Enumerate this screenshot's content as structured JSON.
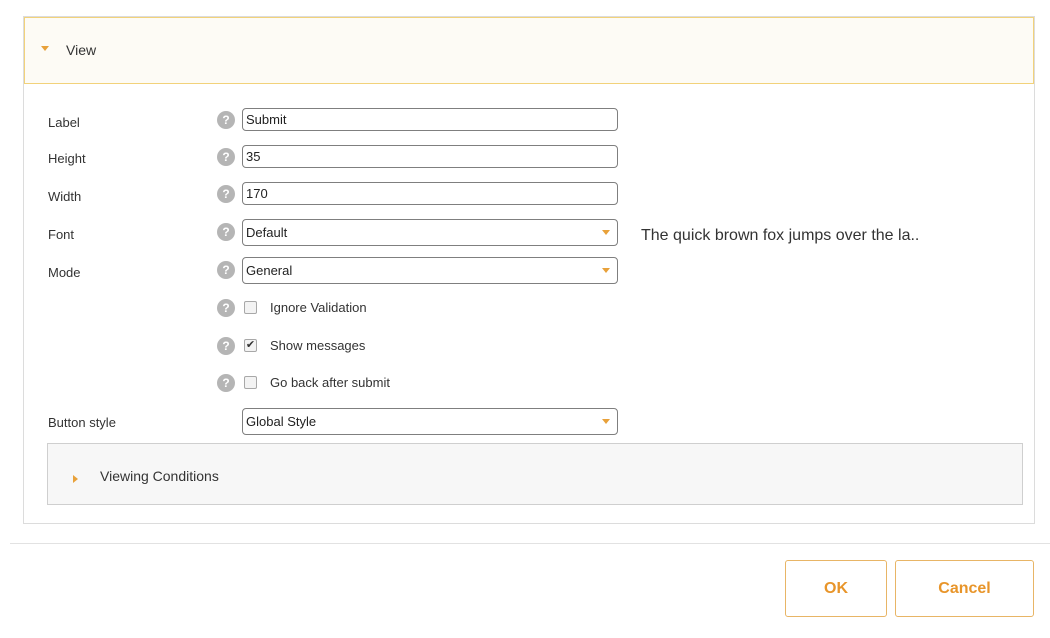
{
  "view_section": {
    "title": "View"
  },
  "fields": {
    "label": {
      "label": "Label",
      "value": "Submit"
    },
    "height": {
      "label": "Height",
      "value": "35"
    },
    "width": {
      "label": "Width",
      "value": "170"
    },
    "font": {
      "label": "Font",
      "value": "Default"
    },
    "mode": {
      "label": "Mode",
      "value": "General"
    },
    "button_style": {
      "label": "Button style",
      "value": "Global Style"
    }
  },
  "font_preview": "The quick brown fox jumps over the la..",
  "help_icon_glyph": "?",
  "checkboxes": [
    {
      "label": "Ignore Validation",
      "checked": false
    },
    {
      "label": "Show messages",
      "checked": true
    },
    {
      "label": "Go back after submit",
      "checked": false
    }
  ],
  "check_glyph": "✔",
  "viewing_conditions": {
    "title": "Viewing Conditions"
  },
  "buttons": {
    "ok": "OK",
    "cancel": "Cancel"
  },
  "colors": {
    "accent": "#e8952a",
    "header_border": "#f2d27a",
    "help_icon": "#b5b5b5"
  }
}
